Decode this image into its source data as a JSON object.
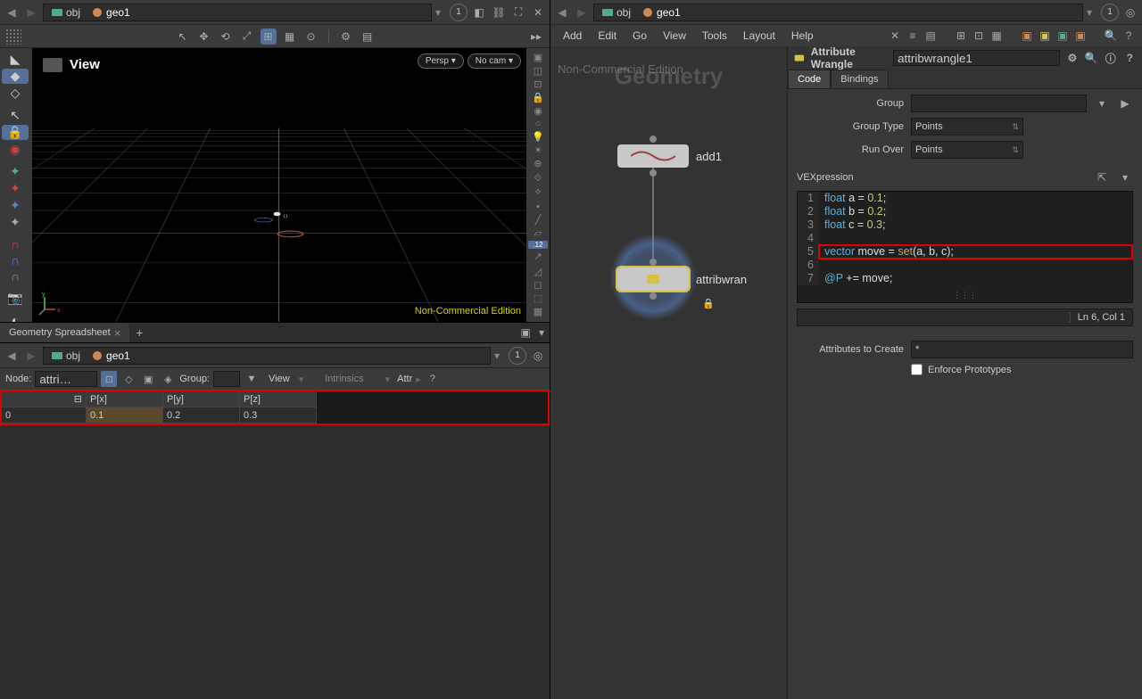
{
  "path": {
    "obj": "obj",
    "geo": "geo1",
    "circled": "1"
  },
  "viewport": {
    "title": "View",
    "persp": "Persp ▾",
    "nocam": "No cam ▾",
    "watermark": "Non-Commercial Edition"
  },
  "tabs": {
    "spreadsheet": "Geometry Spreadsheet"
  },
  "spreadsheet": {
    "node_lbl": "Node:",
    "node_val": "attri…",
    "group_lbl": "Group:",
    "view_lbl": "View",
    "intrinsics_lbl": "Intrinsics",
    "attr_lbl": "Attr",
    "cols": [
      "",
      "P[x]",
      "P[y]",
      "P[z]"
    ],
    "row": [
      "0",
      "0.1",
      "0.2",
      "0.3"
    ]
  },
  "menus": [
    "Add",
    "Edit",
    "Go",
    "View",
    "Tools",
    "Layout",
    "Help"
  ],
  "network": {
    "title": "Geometry",
    "subtitle": "Non-Commercial Edition",
    "node1": "add1",
    "node2": "attribwran"
  },
  "params": {
    "op_type": "Attribute Wrangle",
    "op_name": "attribwrangle1",
    "tabs": [
      "Code",
      "Bindings"
    ],
    "group_lbl": "Group",
    "group_type_lbl": "Group Type",
    "group_type_val": "Points",
    "run_over_lbl": "Run Over",
    "run_over_val": "Points",
    "vex_lbl": "VEXpression",
    "status": "Ln 6, Col 1",
    "attrs_lbl": "Attributes to Create",
    "attrs_val": "*",
    "enforce_lbl": "Enforce Prototypes"
  },
  "code": {
    "l1_a": "float",
    "l1_b": " a = ",
    "l1_c": "0.1",
    "l1_d": ";",
    "l2_a": "float",
    "l2_b": " b = ",
    "l2_c": "0.2",
    "l2_d": ";",
    "l3_a": "float",
    "l3_b": " c = ",
    "l3_c": "0.3",
    "l3_d": ";",
    "l5_a": "vector",
    "l5_b": " move = ",
    "l5_c": "set",
    "l5_d": "(a, b, c);",
    "l7_a": "@P",
    "l7_b": " += move;"
  }
}
